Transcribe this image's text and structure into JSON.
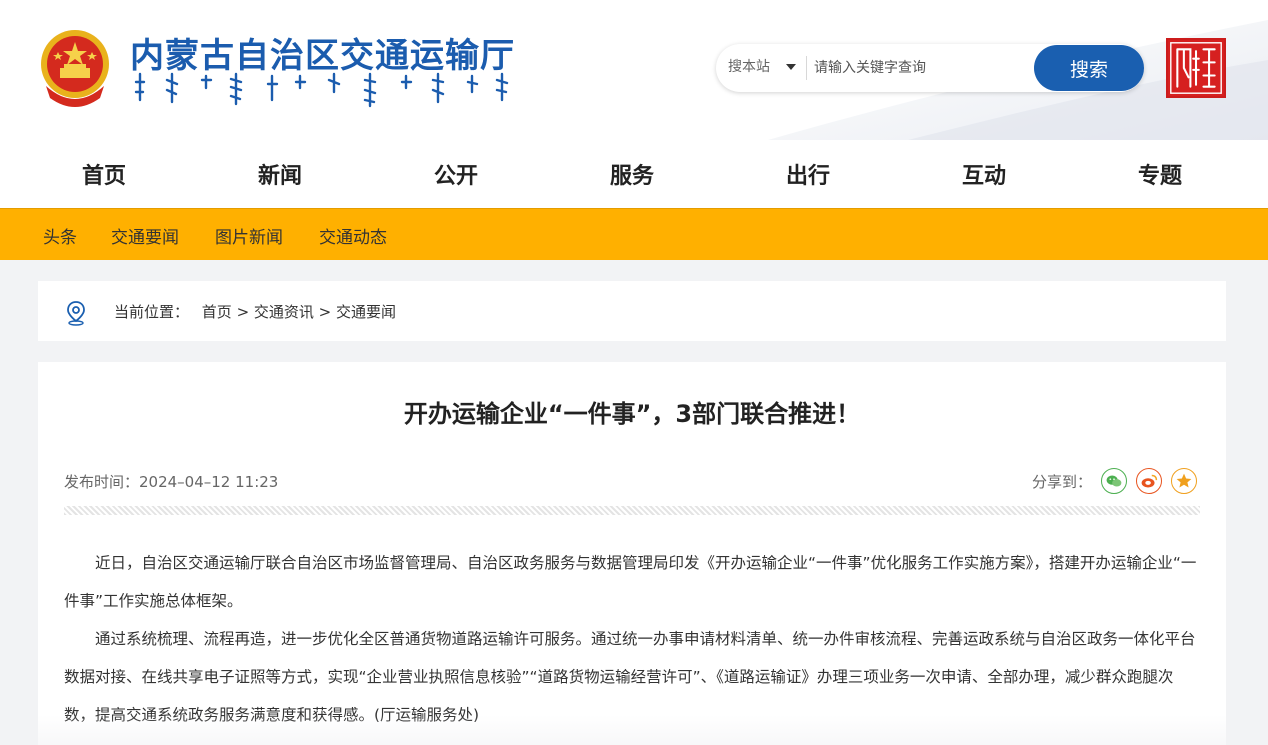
{
  "header": {
    "site_title": "内蒙古自治区交通运输厅",
    "emblem_icon": "national-emblem-icon",
    "mongolian_script_icon": "mongolian-script-title",
    "seal_icon": "inner-mongolia-seal-icon",
    "search": {
      "scope_label": "搜本站",
      "placeholder": "请输入关键字查询",
      "button_label": "搜索"
    }
  },
  "main_nav": {
    "items": [
      "首页",
      "新闻",
      "公开",
      "服务",
      "出行",
      "互动",
      "专题"
    ]
  },
  "sub_nav": {
    "items": [
      "头条",
      "交通要闻",
      "图片新闻",
      "交通动态"
    ],
    "background_color": "#ffb000"
  },
  "breadcrumb": {
    "icon": "location-pin-icon",
    "label": "当前位置：",
    "path": "首页 > 交通资讯 > 交通要闻"
  },
  "article": {
    "title": "开办运输企业“一件事”，3部门联合推进！",
    "publish_time": "发布时间：2024–04–12 11:23",
    "share_label": "分享到：",
    "share_icons": [
      "wechat-icon",
      "weibo-icon",
      "favorite-star-icon"
    ],
    "paragraphs": [
      "近日，自治区交通运输厅联合自治区市场监督管理局、自治区政务服务与数据管理局印发《开办运输企业“一件事”优化服务工作实施方案》，搭建开办运输企业“一件事”工作实施总体框架。",
      "通过系统梳理、流程再造，进一步优化全区普通货物道路运输许可服务。通过统一办事申请材料清单、统一办件审核流程、完善运政系统与自治区政务一体化平台数据对接、在线共享电子证照等方式，实现“企业营业执照信息核验”“道路货物运输经营许可”、《道路运输证》办理三项业务一次申请、全部办理，减少群众跑腿次数，提高交通系统政务服务满意度和获得感。(厅运输服务处)"
    ]
  }
}
